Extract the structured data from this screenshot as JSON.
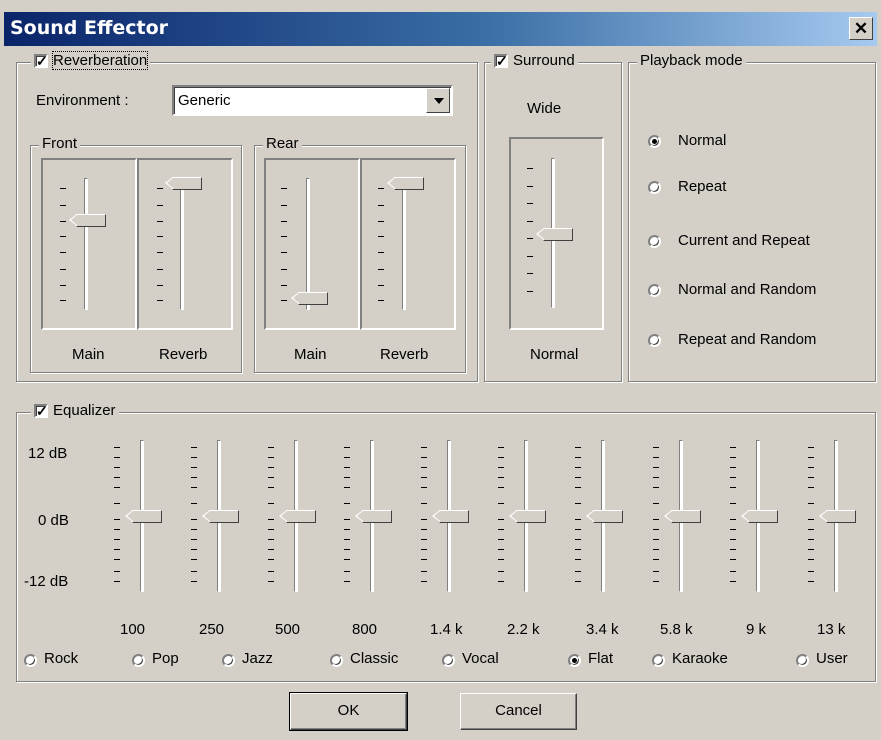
{
  "window": {
    "title": "Sound Effector",
    "close_glyph": "✕"
  },
  "reverb": {
    "label": "Reverberation",
    "checked": true,
    "environment_label": "Environment :",
    "environment_value": "Generic",
    "front": {
      "label": "Front",
      "main_label": "Main",
      "reverb_label": "Reverb"
    },
    "rear": {
      "label": "Rear",
      "main_label": "Main",
      "reverb_label": "Reverb"
    }
  },
  "surround": {
    "label": "Surround",
    "checked": true,
    "top_label": "Wide",
    "bottom_label": "Normal"
  },
  "playback": {
    "label": "Playback mode",
    "options": [
      "Normal",
      "Repeat",
      "Current and Repeat",
      "Normal and Random",
      "Repeat and Random"
    ],
    "selected": "Normal"
  },
  "equalizer": {
    "label": "Equalizer",
    "checked": true,
    "db_labels": [
      "12 dB",
      "0 dB",
      "-12 dB"
    ],
    "bands": [
      "100",
      "250",
      "500",
      "800",
      "1.4 k",
      "2.2 k",
      "3.4 k",
      "5.8 k",
      "9 k",
      "13 k"
    ],
    "presets": [
      "Rock",
      "Pop",
      "Jazz",
      "Classic",
      "Vocal",
      "Flat",
      "Karaoke",
      "User"
    ],
    "selected_preset": "Flat"
  },
  "buttons": {
    "ok": "OK",
    "cancel": "Cancel"
  }
}
